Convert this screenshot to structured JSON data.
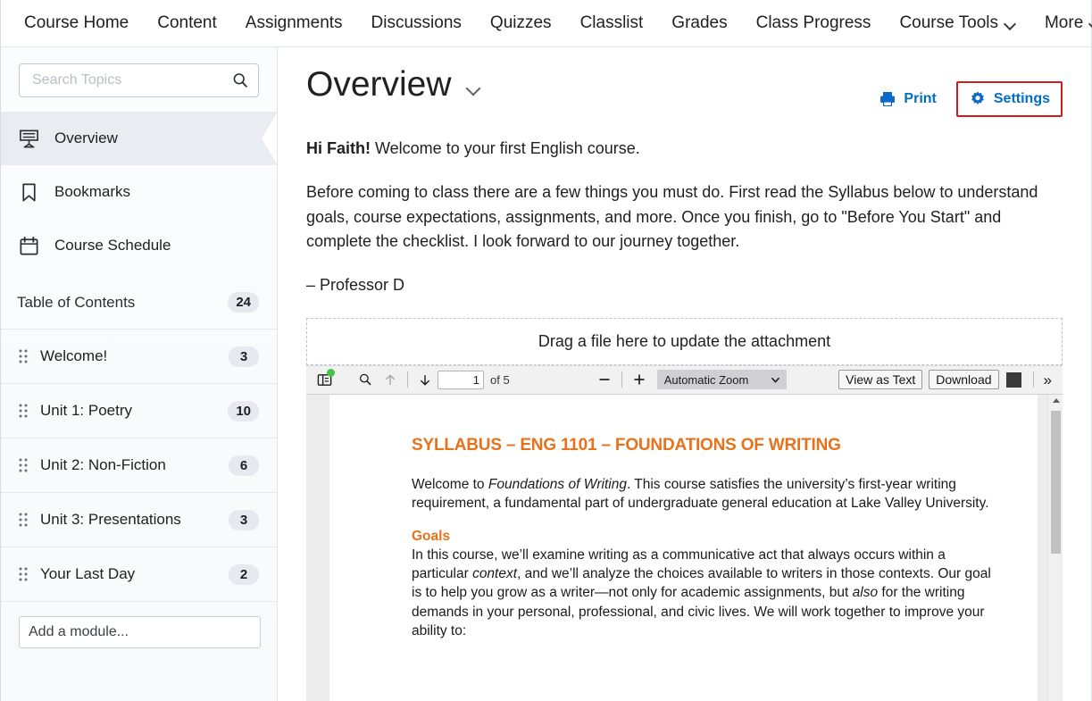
{
  "navbar": {
    "items": [
      {
        "label": "Course Home",
        "has_caret": false
      },
      {
        "label": "Content",
        "has_caret": false
      },
      {
        "label": "Assignments",
        "has_caret": false
      },
      {
        "label": "Discussions",
        "has_caret": false
      },
      {
        "label": "Quizzes",
        "has_caret": false
      },
      {
        "label": "Classlist",
        "has_caret": false
      },
      {
        "label": "Grades",
        "has_caret": false
      },
      {
        "label": "Class Progress",
        "has_caret": false
      },
      {
        "label": "Course Tools",
        "has_caret": true
      },
      {
        "label": "More",
        "has_caret": true
      }
    ]
  },
  "sidebar": {
    "search": {
      "value": "",
      "placeholder": "Search Topics",
      "icon": "search-icon"
    },
    "nav": [
      {
        "label": "Overview",
        "icon": "overview-easel-icon",
        "active": true
      },
      {
        "label": "Bookmarks",
        "icon": "bookmark-icon",
        "active": false
      },
      {
        "label": "Course Schedule",
        "icon": "calendar-icon",
        "active": false
      }
    ],
    "toc": {
      "label": "Table of Contents",
      "count": "24"
    },
    "modules": [
      {
        "label": "Welcome!",
        "count": "3"
      },
      {
        "label": "Unit 1: Poetry",
        "count": "10"
      },
      {
        "label": "Unit 2: Non-Fiction",
        "count": "6"
      },
      {
        "label": "Unit 3: Presentations",
        "count": "3"
      },
      {
        "label": "Your Last Day",
        "count": "2"
      }
    ],
    "add_module": {
      "placeholder": "Add a module...",
      "value": ""
    }
  },
  "main": {
    "title": "Overview",
    "title_caret_icon": "chevron-down-icon",
    "actions": [
      {
        "label": "Print",
        "icon": "printer-icon",
        "highlighted": false
      },
      {
        "label": "Settings",
        "icon": "gear-icon",
        "highlighted": true
      }
    ],
    "intro": {
      "greeting_bold": "Hi Faith!",
      "greeting_rest": " Welcome to your first English course.",
      "paragraph": "Before coming to class there are a few things you must do. First read the Syllabus below to understand goals, course expectations, assignments, and more. Once you finish, go to \"Before You Start\" and complete the checklist. I look forward to our journey together.",
      "signature": "– Professor D"
    },
    "dropzone": {
      "label": "Drag a file here to update the attachment"
    }
  },
  "pdf_toolbar": {
    "sidebar_toggle_icon": "toggle-sidebar-icon",
    "sidebar_toggle_has_badge": true,
    "find_icon": "search-icon",
    "prev_icon": "arrow-up-icon",
    "next_icon": "arrow-down-icon",
    "page_number": "1",
    "page_total_label": "of 5",
    "zoom_out_icon": "minus-icon",
    "zoom_in_icon": "plus-icon",
    "zoom_select": "Automatic Zoom",
    "zoom_select_caret_icon": "chevron-down-icon",
    "view_as_text_label": "View as Text",
    "download_label": "Download",
    "color_swatch": "#3b3b3b",
    "more_tools_icon": "double-chevron-right-icon",
    "accent_badge_color": "#49c24a"
  },
  "pdf_document": {
    "heading": "SYLLABUS – ENG 1101 – FOUNDATIONS OF WRITING",
    "heading_color": "#e8721b",
    "intro_parts": [
      {
        "text": "Welcome to ",
        "italic": false
      },
      {
        "text": "Foundations of Writing",
        "italic": true
      },
      {
        "text": ". This course satisfies the university’s first-year writing requirement, a fundamental part of undergraduate general education at Lake Valley University.",
        "italic": false
      }
    ],
    "goals_heading": "Goals",
    "goals_parts": [
      {
        "text": "In this course, we’ll examine writing as a communicative act that always occurs within a particular ",
        "italic": false
      },
      {
        "text": "context",
        "italic": true
      },
      {
        "text": ", and we’ll analyze the choices available to writers in those contexts. Our goal is to help you grow as a writer—not only for academic assignments, but ",
        "italic": false
      },
      {
        "text": "also",
        "italic": true
      },
      {
        "text": " for the writing demands in your personal, professional, and civic lives. We will work together to improve your ability to:",
        "italic": false
      }
    ]
  },
  "colors": {
    "link_blue": "#006fbf",
    "highlight_red": "#cf1c1c",
    "accent_orange": "#e8721b",
    "sidebar_active": "#e9ecf1"
  }
}
